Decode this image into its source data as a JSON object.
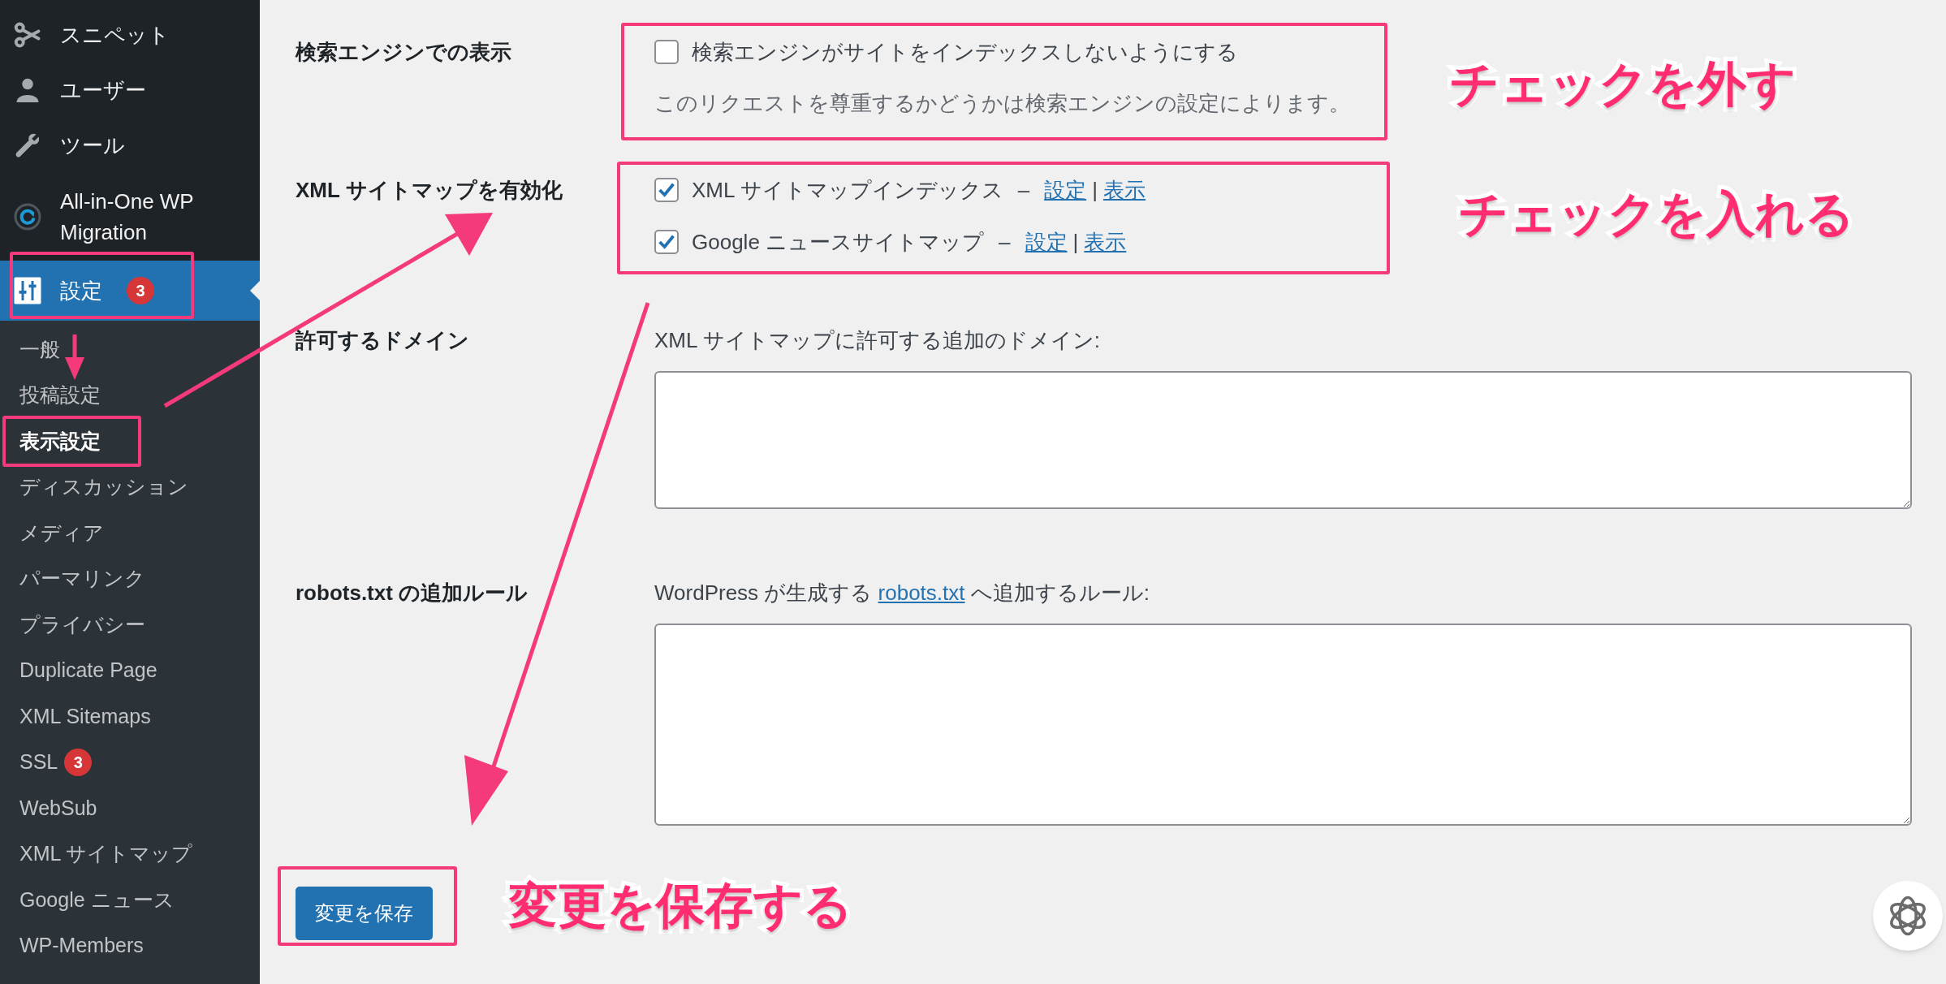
{
  "sidebar": {
    "menu": [
      {
        "label": "スニペット",
        "selected": false
      },
      {
        "label": "ユーザー",
        "selected": false
      },
      {
        "label": "ツール",
        "selected": false
      },
      {
        "label": "All-in-One WP Migration",
        "selected": false
      },
      {
        "label": "設定",
        "badge": "3",
        "selected": true
      }
    ],
    "submenu": [
      {
        "label": "一般",
        "selected": false
      },
      {
        "label": "投稿設定",
        "selected": false
      },
      {
        "label": "表示設定",
        "selected": true
      },
      {
        "label": "ディスカッション",
        "selected": false
      },
      {
        "label": "メディア",
        "selected": false
      },
      {
        "label": "パーマリンク",
        "selected": false
      },
      {
        "label": "プライバシー",
        "selected": false
      },
      {
        "label": "Duplicate Page",
        "selected": false
      },
      {
        "label": "XML Sitemaps",
        "selected": false
      },
      {
        "label": "SSL",
        "badge": "3",
        "selected": false
      },
      {
        "label": "WebSub",
        "selected": false
      },
      {
        "label": "XML サイトマップ",
        "selected": false
      },
      {
        "label": "Google ニュース",
        "selected": false
      },
      {
        "label": "WP-Members",
        "selected": false
      }
    ]
  },
  "settings": [
    {
      "kind": "checkboxes",
      "label": "検索エンジンでの表示",
      "options": [
        {
          "label": "検索エンジンがサイトをインデックスしないようにする",
          "checked": false
        }
      ],
      "description": "このリクエストを尊重するかどうかは検索エンジンの設定によります。"
    },
    {
      "kind": "checkboxes",
      "label": "XML サイトマップを有効化",
      "options": [
        {
          "label": "XML サイトマップインデックス",
          "checked": true,
          "separator": "–",
          "links": [
            "設定",
            "表示"
          ],
          "link_separator": "|"
        },
        {
          "label": "Google ニュースサイトマップ",
          "checked": true,
          "separator": "–",
          "links": [
            "設定",
            "表示"
          ],
          "link_separator": "|"
        }
      ]
    },
    {
      "kind": "textarea",
      "label": "許可するドメイン",
      "description": "XML サイトマップに許可する追加のドメイン:"
    },
    {
      "kind": "textarea",
      "label": "robots.txt の追加ルール",
      "description_before": "WordPress が生成する",
      "description_link": "robots.txt",
      "description_after": "へ追加するルール:"
    }
  ],
  "save_button": "変更を保存",
  "callouts": [
    {
      "text": "チェックを外す"
    },
    {
      "text": "チェックを入れる"
    },
    {
      "text": "変更を保存する"
    }
  ]
}
